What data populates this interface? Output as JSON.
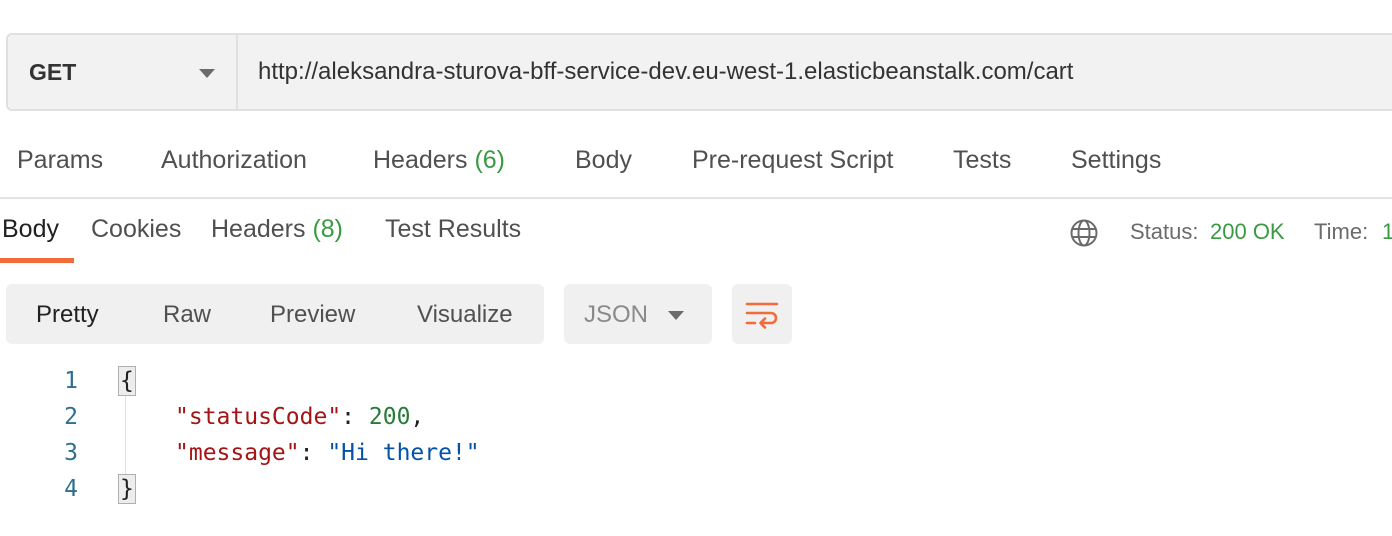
{
  "request": {
    "method": "GET",
    "url": "http://aleksandra-sturova-bff-service-dev.eu-west-1.elasticbeanstalk.com/cart"
  },
  "request_tabs": [
    {
      "label": "Params"
    },
    {
      "label": "Authorization"
    },
    {
      "label": "Headers",
      "count": "(6)"
    },
    {
      "label": "Body"
    },
    {
      "label": "Pre-request Script"
    },
    {
      "label": "Tests"
    },
    {
      "label": "Settings"
    }
  ],
  "response_tabs": [
    {
      "label": "Body",
      "active": true
    },
    {
      "label": "Cookies"
    },
    {
      "label": "Headers",
      "count": "(8)"
    },
    {
      "label": "Test Results"
    }
  ],
  "response_meta": {
    "status_label": "Status:",
    "status_value": "200 OK",
    "time_label": "Time:",
    "time_value": "1"
  },
  "view_modes": {
    "pretty": "Pretty",
    "raw": "Raw",
    "preview": "Preview",
    "visualize": "Visualize",
    "active": "Pretty"
  },
  "format": {
    "selected": "JSON"
  },
  "icons": {
    "method_caret": "chevron-down-icon",
    "network": "globe-icon",
    "format_caret": "chevron-down-icon",
    "wrap": "wrap-lines-icon"
  },
  "colors": {
    "accent": "#f26b3a",
    "success": "#3a9a43",
    "json_key": "#a31515",
    "json_number": "#2b7a3b",
    "json_string": "#0451a5",
    "line_number": "#2f6f8f"
  },
  "code": {
    "line_numbers": [
      "1",
      "2",
      "3",
      "4"
    ],
    "open_brace": "{",
    "close_brace": "}",
    "colon": ": ",
    "comma": ",",
    "entries": [
      {
        "key": "\"statusCode\"",
        "value": "200"
      },
      {
        "key": "\"message\"",
        "value": "\"Hi there!\""
      }
    ]
  }
}
